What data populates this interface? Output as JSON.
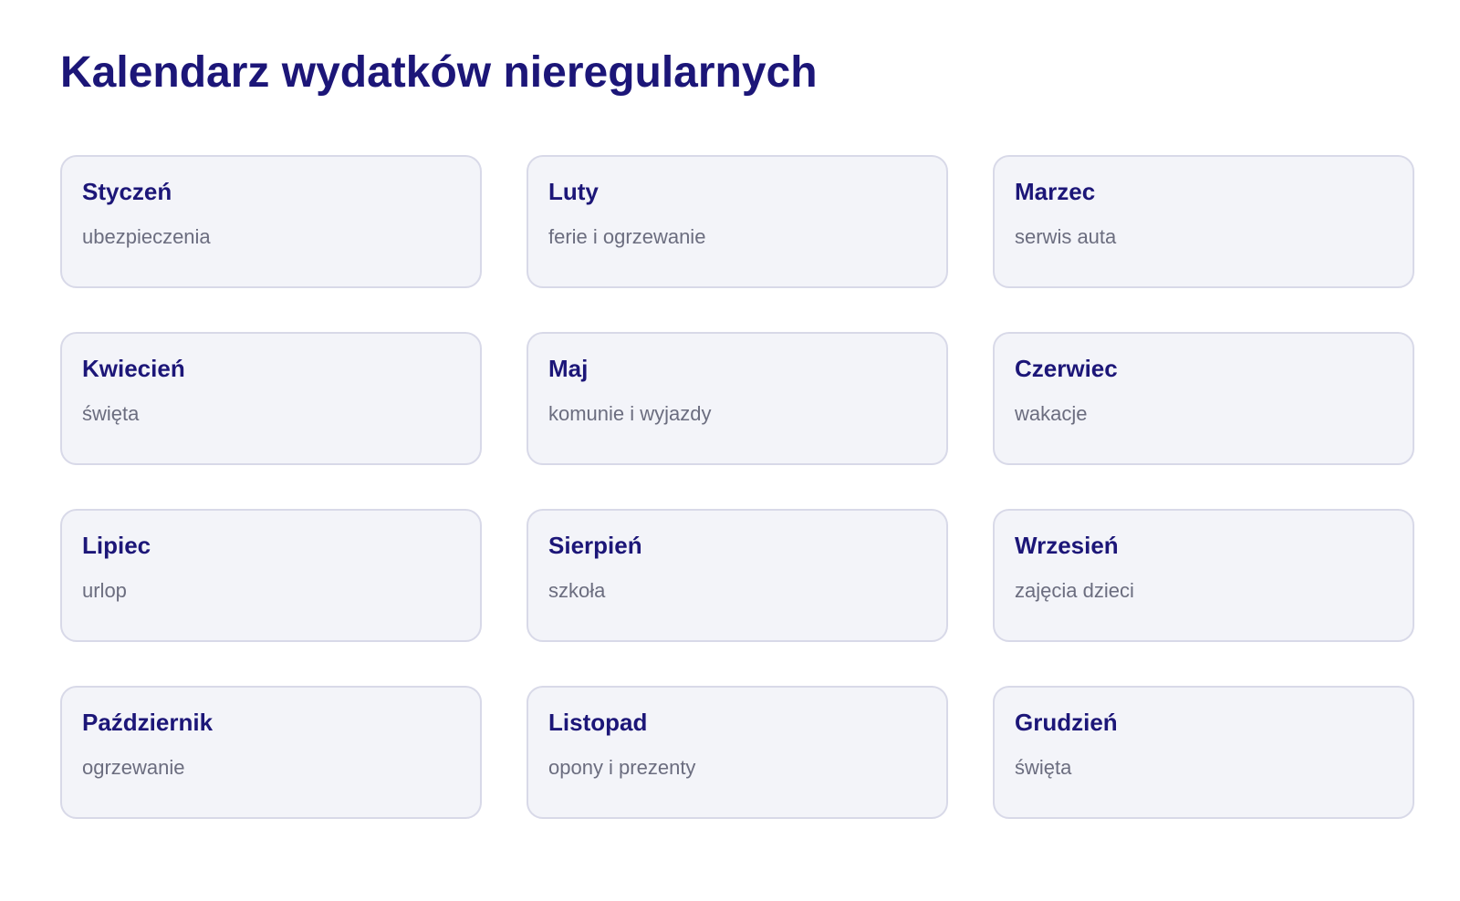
{
  "page": {
    "title": "Kalendarz wydatków nieregularnych"
  },
  "months": [
    {
      "name": "Styczeń",
      "description": "ubezpieczenia"
    },
    {
      "name": "Luty",
      "description": "ferie i ogrzewanie"
    },
    {
      "name": "Marzec",
      "description": "serwis auta"
    },
    {
      "name": "Kwiecień",
      "description": "święta"
    },
    {
      "name": "Maj",
      "description": "komunie i wyjazdy"
    },
    {
      "name": "Czerwiec",
      "description": "wakacje"
    },
    {
      "name": "Lipiec",
      "description": "urlop"
    },
    {
      "name": "Sierpień",
      "description": "szkoła"
    },
    {
      "name": "Wrzesień",
      "description": "zajęcia dzieci"
    },
    {
      "name": "Październik",
      "description": "ogrzewanie"
    },
    {
      "name": "Listopad",
      "description": "opony i prezenty"
    },
    {
      "name": "Grudzień",
      "description": "święta"
    }
  ],
  "colors": {
    "heading": "#1c1678",
    "card_background": "#f3f4f9",
    "card_border": "#d8d9e8",
    "description_text": "#6b6d7f"
  }
}
